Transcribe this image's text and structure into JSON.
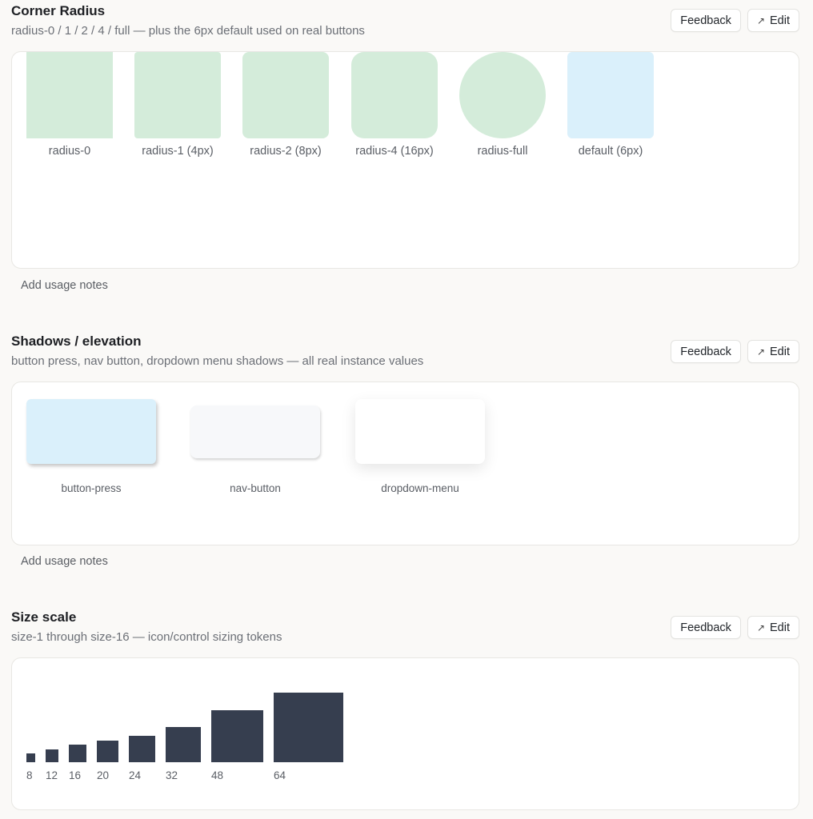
{
  "sections": {
    "radius": {
      "title": "Corner Radius",
      "subtitle": "radius-0 / 1 / 2 / 4 / full — plus the 6px default used on real buttons",
      "swatches": [
        {
          "label": "radius-0",
          "color": "#d4ecda"
        },
        {
          "label": "radius-1 (4px)",
          "color": "#d4ecda"
        },
        {
          "label": "radius-2 (8px)",
          "color": "#d4ecda"
        },
        {
          "label": "radius-4 (16px)",
          "color": "#d4ecda"
        },
        {
          "label": "radius-full",
          "color": "#d4ecda"
        },
        {
          "label": "default (6px)",
          "color": "#daf0fb"
        }
      ],
      "notes": "Add usage notes"
    },
    "shadows": {
      "title": "Shadows / elevation",
      "subtitle": "button press, nav button, dropdown menu shadows — all real instance values",
      "swatches": [
        {
          "label": "button-press",
          "color": "#daf0fb"
        },
        {
          "label": "nav-button",
          "color": "#f7f8fa"
        },
        {
          "label": "dropdown-menu",
          "color": "#ffffff"
        }
      ],
      "notes": "Add usage notes"
    },
    "size": {
      "title": "Size scale",
      "subtitle": "size-1 through size-16 — icon/control sizing tokens",
      "bar_color": "#363e4f"
    }
  },
  "buttons": {
    "feedback": "Feedback",
    "edit": "Edit",
    "edit_icon": "↗"
  },
  "chart_data": {
    "type": "bar",
    "categories": [
      "8",
      "12",
      "16",
      "20",
      "24",
      "32",
      "48",
      "64"
    ],
    "values": [
      8,
      12,
      16,
      20,
      24,
      32,
      48,
      64
    ]
  }
}
